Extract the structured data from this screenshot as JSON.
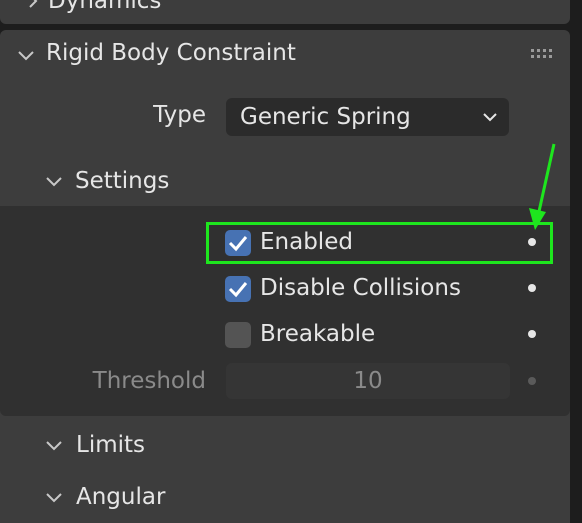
{
  "panels": {
    "dynamics": {
      "title": "Dynamics",
      "expanded": false
    },
    "constraint": {
      "title": "Rigid Body Constraint",
      "grip_icon": "drag-grip-icon",
      "type_label": "Type",
      "type_value": "Generic Spring",
      "settings": {
        "title": "Settings",
        "enabled_label": "Enabled",
        "enabled_checked": true,
        "disable_collisions_label": "Disable Collisions",
        "disable_collisions_checked": true,
        "breakable_label": "Breakable",
        "breakable_checked": false,
        "threshold_label": "Threshold",
        "threshold_value": "10"
      },
      "limits_title": "Limits",
      "angular_title": "Angular"
    }
  },
  "annotation": {
    "color": "#1ee61e"
  },
  "colors": {
    "accent": "#4772b3",
    "panel": "#3d3d3d",
    "subpanel": "#303030"
  }
}
